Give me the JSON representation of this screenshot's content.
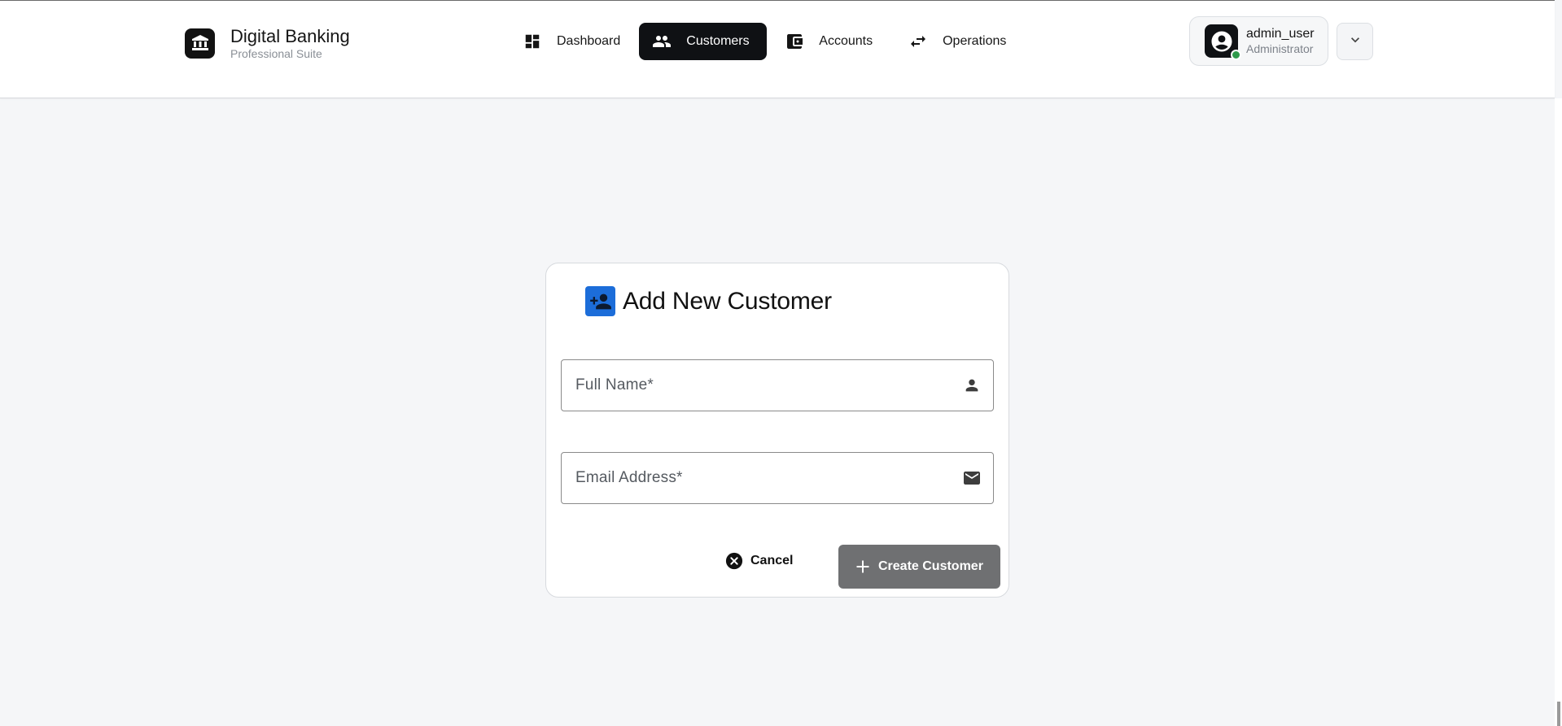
{
  "brand": {
    "title": "Digital Banking",
    "subtitle": "Professional Suite",
    "logo_icon": "bank-icon"
  },
  "nav": {
    "items": [
      {
        "label": "Dashboard",
        "icon": "dashboard-icon",
        "active": false
      },
      {
        "label": "Customers",
        "icon": "people-icon",
        "active": true
      },
      {
        "label": "Accounts",
        "icon": "wallet-icon",
        "active": false
      },
      {
        "label": "Operations",
        "icon": "swap-arrows-icon",
        "active": false
      }
    ]
  },
  "user": {
    "name": "admin_user",
    "role": "Administrator",
    "status_color": "#2e9a4a",
    "menu_icon": "chevron-down-icon"
  },
  "form": {
    "title": "Add New Customer",
    "title_icon": "person-add-icon",
    "fields": {
      "name": {
        "value": "",
        "placeholder": "Full Name*",
        "icon": "person-icon"
      },
      "email": {
        "value": "",
        "placeholder": "Email Address*",
        "icon": "email-icon"
      }
    },
    "cancel_label": "Cancel",
    "create_label": "Create Customer"
  },
  "colors": {
    "accent": "#1c6dd9",
    "nav_active_bg": "#0f1114",
    "create_button_bg": "#6f7072",
    "page_bg": "#f5f6f8"
  }
}
